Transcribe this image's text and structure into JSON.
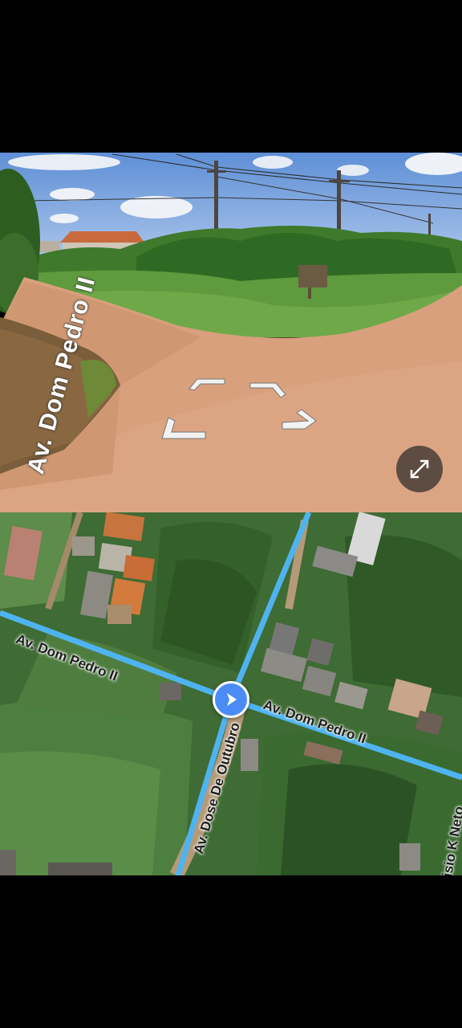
{
  "street_view": {
    "road_label": "Av. Dom Pedro II",
    "controls": {
      "expand_icon": "expand-diagonal-arrows",
      "nav_icons": [
        "chevron-up-left",
        "chevron-up-right",
        "chevron-down-left",
        "chevron-down-right"
      ]
    }
  },
  "map": {
    "street_labels": {
      "dom_pedro_west": "Av. Dom Pedro II",
      "dom_pedro_east": "Av. Dom Pedro II",
      "dose_de_outubro": "Av. Dose De Outubro",
      "k_neto": "isio K Neto"
    },
    "marker_icon": "navigation-arrow",
    "road_highlight_color": "#4fb3f0",
    "marker_color": "#4b8bf5"
  }
}
